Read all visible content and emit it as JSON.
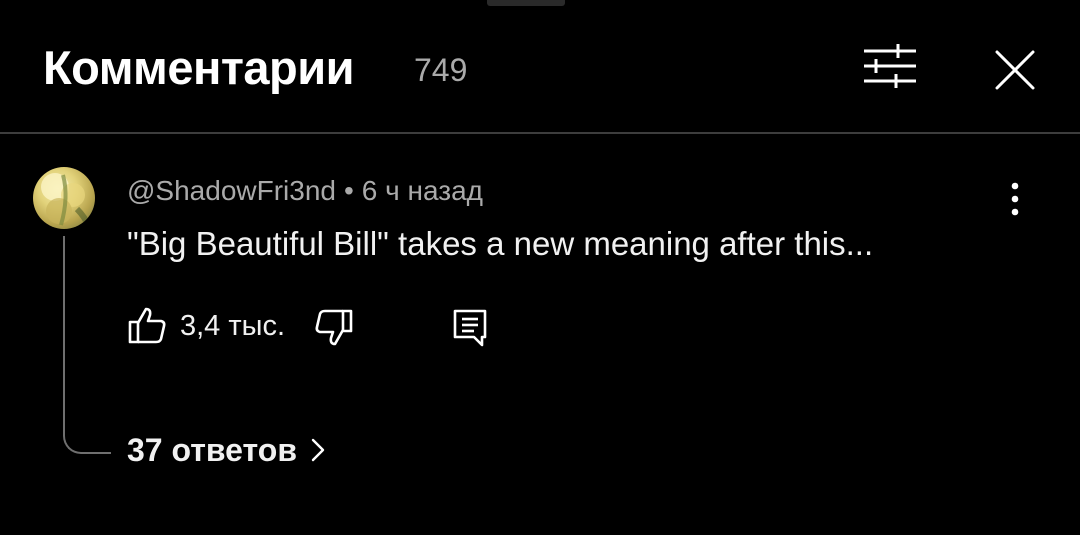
{
  "header": {
    "title": "Комментарии",
    "count": "749"
  },
  "icons": {
    "filter": "sliders-icon",
    "close": "close-icon",
    "more": "more-vert-icon",
    "like": "thumb-up-icon",
    "dislike": "thumb-down-icon",
    "reply": "comment-icon",
    "replies_chevron": "chevron-right-icon"
  },
  "comment": {
    "author": "@ShadowFri3nd",
    "separator": "•",
    "time": "6 ч назад",
    "text": "\"Big Beautiful Bill\" takes a new meaning after this...",
    "likes": "3,4 тыс.",
    "replies_label": "37 ответов"
  },
  "colors": {
    "background": "#000000",
    "primary_text": "#f1f1f1",
    "secondary_text": "#aaaaaa",
    "divider": "#3d3d3d"
  }
}
